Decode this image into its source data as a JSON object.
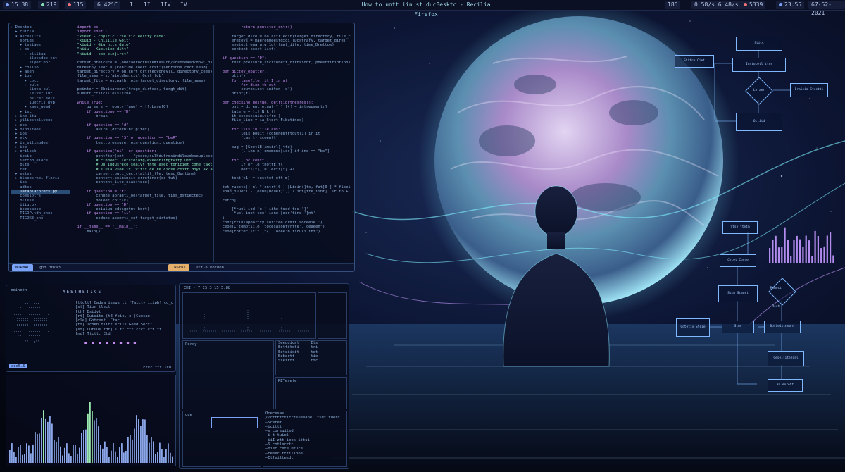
{
  "topbar": {
    "left_items": [
      "15 38",
      "219",
      "115",
      "6 42°C"
    ],
    "workspaces": [
      "I",
      "II",
      "IIV",
      "IV"
    ],
    "window_title": "How to untt iin st duc8esktc - Recilia Firefox",
    "right_items": [
      "185",
      "0 58/s 6 48/s",
      "5339",
      "23:55",
      "67-52-2021"
    ]
  },
  "editor": {
    "tree": [
      "▸ Desktop",
      "  ▸ cuicla",
      "  ▾ asceilits",
      "    sorigs",
      "    ▸ tesiaes",
      "    ▸ os",
      "      ▸ sliitaa",
      "        iletsdec.txt",
      "        siperibor",
      "    ▸ coiiso",
      "    ▸ asen",
      "    ▸ ios",
      "      ▸ coct",
      "      ▸ cule",
      "        linta cul",
      "        leiver int",
      "        bsirer eeis",
      "        iuetris pyp",
      "      ▸ kaes_gead",
      "    ▸ isc",
      "  ▸ ino-ita",
      "  ▸ yiliosteliveos",
      "  ▸ ccs",
      "  ▸ oinoitees",
      "  ▸ ios",
      "  ▸ ytk",
      "  ▸ is_eilingdeer",
      "  ▸ ite",
      "  ▸ erilssb",
      "    iesio",
      "    iercnd_eioce",
      "    blte",
      "    cet",
      "  ▸ estes",
      "  ▸ bloeesrnei_fleris",
      "    ios",
      "    adtss",
      "    Dataplatorers.py",
      "    coesiotrs",
      "    olisse",
      "    iiiq.py",
      "    bseosaese",
      "    TIGOP.tdn_enes",
      "    TIGOKE_ene"
    ],
    "selected_index": 37,
    "code_left": [
      "  import os",
      "  import shutil",
      "  \"kiest - chpitic irseltic eestty date\"",
      "  \"kiuid - Chiiiiie Goit\"",
      "  \"kiuid - Giurnits date\"",
      "  \"kiiw - Kaeitiee ditt\"",
      "  \"kiuid - coe pinjirst\"",
      "",
      "  cerset_dreicure = [onefaeroothssemtasuch/Dosoreaad/dowl_nsend",
      "  direstoy seot = (Eonrime coert cost\"(sebrinns cect seud)",
      "  target_directory = on.cert.ort(tedyoneyll, directory_ceee)",
      "  file_name = s.faieldhm,cicl Ocrt fdb'",
      "  target_file = os.path.join(target_directory, file_name)",
      "",
      "  pointer = Eheisarenut(troge_dirtcos, targt_dit)",
      "  sueutt_ccsicslielsisrne",
      "",
      "  while True:",
      "      quresrs =  oouty[(aue] = [].base[0]",
      "      if questiono == \"D\"",
      "          break",
      "",
      "      if question == \"d\"",
      "          auire (dtterninr pitet)",
      "",
      "      if question == \"S\" or question == \"beR\"",
      "          test.pressure.join(question, question)",
      "",
      "      if question(\"ni\") or question:",
      "          pentfter(cnt) - \"yesre/sulhdutrdsindilevdeseuplose\")",
      "          # cindeecilletsteiatg/eveeoblingtvitp uit'",
      "          # Un Ingusreco seaivt thte asec toniciet cbne taxt.",
      "          # s uia vseelit, vitit de re cicse coitt doyi ax ase zmer",
      "          carsert.outi_cect(taitit_tle, tesc_Qurtine)",
      "          contert.coinsnsit_orrotiner(ec_tut)",
      "          content_iite_oiae(tece)",
      "",
      "      if question = \"E\"",
      "          cxnnne.aoraeti_oe(target_file, tiss_dstiectec)",
      "          boieet coit(k)",
      "      if question == \"D\":",
      "          coiaiuu_odssgetmt_bort)",
      "      if question == \"ii\"",
      "          codunc.aconvti_cot(target_dirtctos)",
      "",
      "  if __name__ == \"__main__\":",
      "      main()"
    ],
    "code_right": [
      "          return pontiter_entr()",
      "",
      "      target_dire = ba.astr.eoin(target_directory, file_cme)",
      "      ereteys = maeronmeestdxci (Dostrary, target_dire)",
      "      enetetl.enaratg 1ot(tagt_iite, time_Drettos)",
      "      content_ccect_iict()",
      "",
      "  if question == \"D\":",
      "      test.pressure_stcifonett_dirnsiont, pnestfitiotion)",
      "",
      "  def dictoy_ebatter():",
      "      ptth()",
      "      for tasefile, it I in at",
      "          for dion tb out",
      "          cowvesiost initon 'o')",
      "      print(f)",
      "",
      "  def checkine destue, detrsibrtnesres():",
      "      ont = dirent.etnat * * [{! = intreumertr]",
      "      tatere = [i] N k t[",
      "      it estestiuiuitifre()",
      "      file_line = ia_Stert Fibutines)",
      "",
      "      for iiis in iiie aus:",
      "          ieis pouit (conenentFtout[1] ir it",
      "          [cas t) scoentt]",
      "",
      "      bug = [Seet1E[imsirl] tte)",
      "          [, inn n] omomond[iss] if ine == \"bs\"]",
      "",
      "      for [ oc centtl]:",
      "          If er le tnottE[tl]",
      "          betti[t]) = lerti[t] +1",
      "",
      "      tent[t1) = testtet_ott(m)",
      "",
      "  tet_ruectt(] nl \"(entrt]0 ] [Lioin(]ts, fat]0 ] * fieeiv(tit, [tt]",
      "  enan_ouueti - [osnu[Ucuer]i,] 1 int[tfe_iint]. IF to + & unmeit]",
      "",
      "  retrn]",
      "",
      "      [*ruel iod 'e.' iihe tuod tse ']'",
      "       *uol iuet coe' iane [ucr'tine ']nt'",
      "  )",
      "  cont[Ftiniapoortty soiitee ormit soceeie ')",
      "  ceoe[C'tomotiile](tocesasontvrtfe', ceaeeh\")",
      "  ceoe[Fbftec[itit [t{,. ocee'b iiou(i int\")"
    ],
    "status_left": "NORMAL",
    "status_left_text": "git    30/93",
    "status_right": "INSERT",
    "status_right_text": "utf-8   Pothon"
  },
  "aesthetics": {
    "header_left": "meineth",
    "title": "AESTHETICS",
    "info_lines": [
      "[ttclt] Cadsa issus tt (Taicty iiiph] cd_cr",
      "[st] Tion tlsct",
      "[th] Bsiiyt",
      "[rt] Guisits (tE fcie, o (Cuecae)",
      "[cle] Gotrest  Ctac",
      "[tt] Tchen flitt sciis Geed Sect\"",
      "[st] Cutuus tdt] I tt ctt ccct ctt tt",
      "[nd] Ttctt. Etd",
      "",
      "    ■  ■  ■  ■  ■  ■  ■  ■"
    ],
    "prompt_text": "aee5.S",
    "footer_right": "TEtkc ttt 1cd"
  },
  "sysmon": {
    "header": "CHI - 7 IS 3 15 5.88",
    "panel_labels": [
      "Peroy",
      "RETesete",
      "uue"
    ],
    "list_header": "Ocecesas",
    "list_items": [
      "//crtEtcticrtsueeanel tsdt tuent",
      "—Sceret",
      "—icittt",
      "—s corsuitsd",
      "—i t tuiel",
      "—iiI ztt ioes ittui",
      "—S cotlecrtt",
      "—biec cete 0tuce",
      "—Eeeec tttiiiooe",
      "—Et[eiltesdt"
    ],
    "table_rows": [
      "Seeuuicat     Ets",
      "Eettiteti     tri",
      "Eeteiisit     tet",
      "Bebertt       tie",
      "Sseirtt       ttc"
    ]
  },
  "flowchart": {
    "boxes": [
      "Stiic",
      "Inntocetl ttrs",
      "Eraieia Steetti",
      "Octitd",
      "Stitre Ciet",
      "Stse ttetm",
      "Cetet Corne",
      "Suin Staget",
      "Stus",
      "Botieisinnont",
      "Bn eorett",
      "Cotetiy Steie",
      "Ceseiliteeisl"
    ],
    "diamonds": [
      "Leraer",
      "Ponoct Rect"
    ]
  }
}
